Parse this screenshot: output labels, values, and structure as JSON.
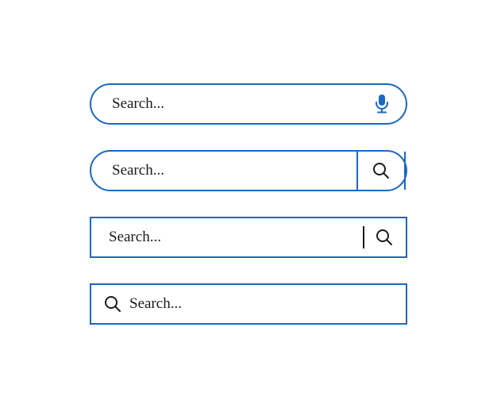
{
  "colors": {
    "accent": "#1968c4",
    "text": "#1a1a1a"
  },
  "bars": [
    {
      "placeholder": "Search...",
      "icon": "microphone-icon"
    },
    {
      "placeholder": "Search...",
      "icon": "magnifier-icon"
    },
    {
      "placeholder": "Search...",
      "icon": "magnifier-icon"
    },
    {
      "placeholder": "Search...",
      "icon": "magnifier-icon"
    }
  ]
}
